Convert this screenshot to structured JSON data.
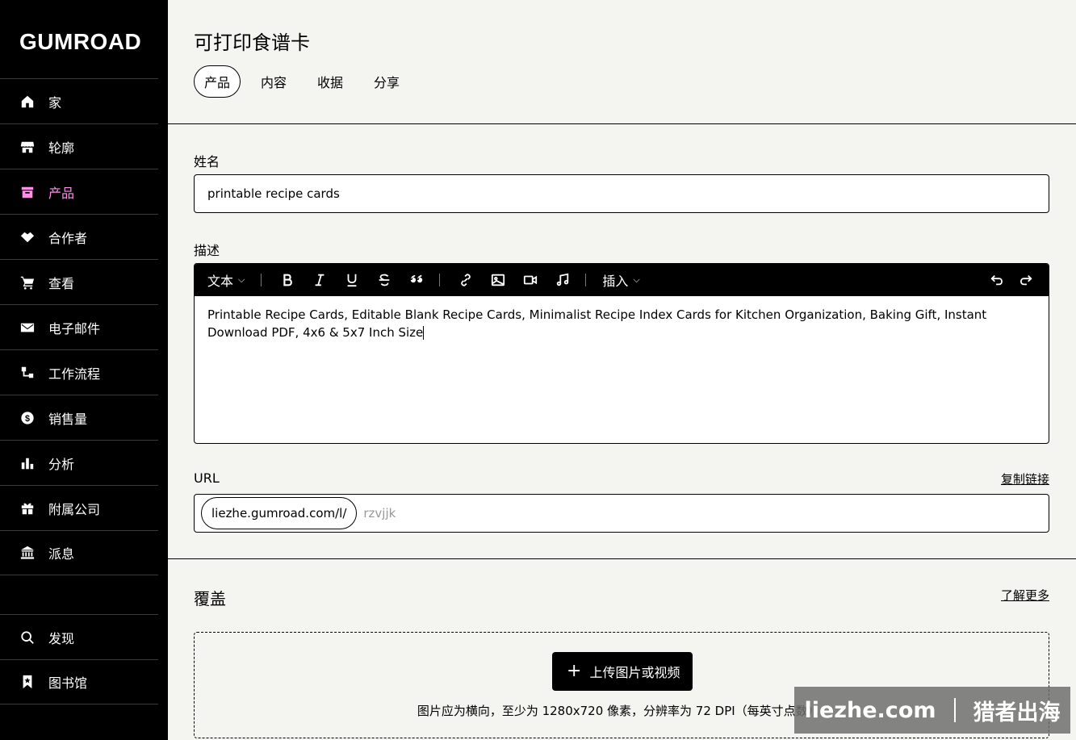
{
  "brand": {
    "logo": "GUMROAD",
    "accent": "#ff90e8"
  },
  "sidebar": {
    "items": [
      {
        "label": "家",
        "icon": "home-icon"
      },
      {
        "label": "轮廓",
        "icon": "store-icon"
      },
      {
        "label": "产品",
        "icon": "archive-icon",
        "active": true
      },
      {
        "label": "合作者",
        "icon": "handshake-icon"
      },
      {
        "label": "查看",
        "icon": "cart-icon"
      },
      {
        "label": "电子邮件",
        "icon": "envelope-icon"
      },
      {
        "label": "工作流程",
        "icon": "workflow-icon"
      },
      {
        "label": "销售量",
        "icon": "dollar-icon"
      },
      {
        "label": "分析",
        "icon": "bar-chart-icon"
      },
      {
        "label": "附属公司",
        "icon": "gift-icon"
      },
      {
        "label": "派息",
        "icon": "bank-icon"
      }
    ],
    "bottom_items": [
      {
        "label": "发现",
        "icon": "search-icon"
      },
      {
        "label": "图书馆",
        "icon": "bookmark-icon"
      }
    ]
  },
  "header": {
    "title": "可打印食谱卡",
    "tabs": [
      "产品",
      "内容",
      "收据",
      "分享"
    ],
    "active_tab": "产品"
  },
  "form": {
    "name_label": "姓名",
    "name_value": "printable recipe cards",
    "description_label": "描述",
    "toolbar": {
      "text_style": "文本",
      "insert": "插入"
    },
    "description_value": "Printable Recipe Cards, Editable Blank Recipe Cards, Minimalist Recipe Index Cards for Kitchen Organization, Baking Gift, Instant Download PDF, 4x6 & 5x7 Inch Size",
    "url_label": "URL",
    "copy_link": "复制链接",
    "url_prefix": "liezhe.gumroad.com/l/",
    "url_slug_placeholder": "rzvjjk"
  },
  "cover": {
    "title": "覆盖",
    "learn_more": "了解更多",
    "upload_button": "上传图片或视频",
    "hint": "图片应为横向，至少为 1280x720 像素，分辨率为 72 DPI（每英寸点数）。"
  },
  "watermark": {
    "left": "liezhe.com",
    "right": "猎者出海"
  }
}
